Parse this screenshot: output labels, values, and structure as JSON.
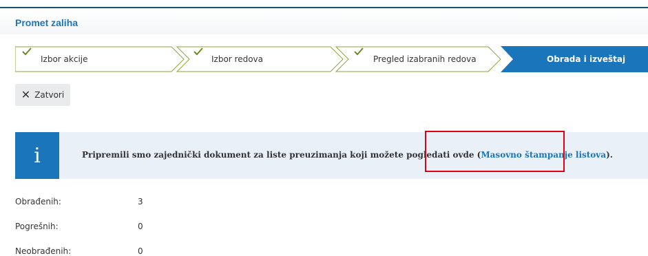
{
  "header": {
    "title": "Promet zaliha"
  },
  "wizard": {
    "steps": [
      {
        "label": "Izbor akcije",
        "done": true
      },
      {
        "label": "Izbor redova",
        "done": true
      },
      {
        "label": "Pregled izabranih redova",
        "done": true
      },
      {
        "label": "Obrada i izveštaj",
        "active": true
      }
    ]
  },
  "toolbar": {
    "close_label": "Zatvori",
    "close_icon": "close-icon"
  },
  "info": {
    "icon": "info-icon",
    "icon_glyph": "i",
    "text_before": "Pripremili smo zajednički dokument za liste preuzimanja koji možete pogledati ovde (",
    "link_text": "Masovno štampanje listova",
    "text_after": ")."
  },
  "stats": [
    {
      "label": "Obrađenih:",
      "value": "3"
    },
    {
      "label": "Pogrešnih:",
      "value": "0"
    },
    {
      "label": "Neobrađenih:",
      "value": "0"
    }
  ],
  "colors": {
    "accent": "#1b75bb",
    "step_border": "#8aa63a",
    "highlight": "#e0000f",
    "info_bg": "#e9f0f7"
  }
}
